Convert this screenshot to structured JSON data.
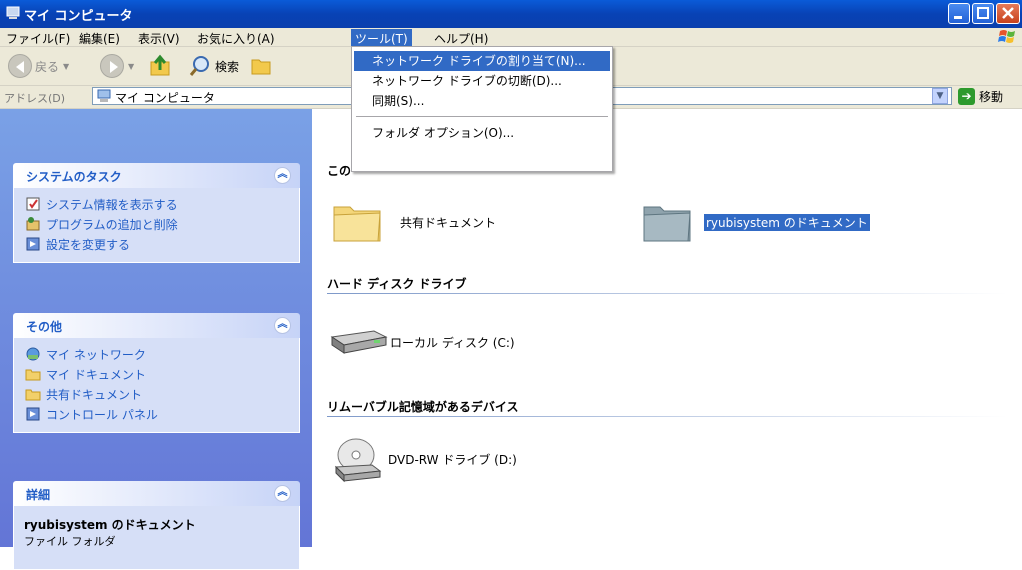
{
  "window": {
    "title": "マイ コンピュータ"
  },
  "menubar": {
    "items": [
      {
        "label": "ファイル(F)"
      },
      {
        "label": "編集(E)"
      },
      {
        "label": "表示(V)"
      },
      {
        "label": "お気に入り(A)"
      },
      {
        "label": "ツール(T)",
        "active": true
      },
      {
        "label": "ヘルプ(H)"
      }
    ]
  },
  "toolbar": {
    "back_label": "戻る",
    "search_label": "検索"
  },
  "address": {
    "label": "アドレス(D)",
    "value": "マイ コンピュータ",
    "go_label": "移動"
  },
  "tools_menu": {
    "items": [
      {
        "label": "ネットワーク ドライブの割り当て(N)...",
        "highlighted": true
      },
      {
        "label": "ネットワーク ドライブの切断(D)..."
      },
      {
        "label": "同期(S)..."
      },
      {
        "label": "フォルダ オプション(O)..."
      }
    ]
  },
  "sidebar": {
    "system_tasks": {
      "title": "システムのタスク",
      "items": [
        "システム情報を表示する",
        "プログラムの追加と削除",
        "設定を変更する"
      ]
    },
    "other_places": {
      "title": "その他",
      "items": [
        "マイ ネットワーク",
        "マイ ドキュメント",
        "共有ドキュメント",
        "コントロール パネル"
      ]
    },
    "details": {
      "title": "詳細",
      "name": "ryubisystem のドキュメント",
      "type": "ファイル フォルダ"
    }
  },
  "content": {
    "group_files_partial": "この",
    "group_hdd": "ハード ディスク ドライブ",
    "group_removable": "リムーバブル記憶域があるデバイス",
    "shared_docs": "共有ドキュメント",
    "user_docs": "ryubisystem のドキュメント",
    "local_disk": "ローカル ディスク (C:)",
    "dvd_drive": "DVD-RW ドライブ (D:)"
  },
  "colors": {
    "accent": "#316ac5",
    "titlebar": "#0a5bd8",
    "sidebar_link": "#215dc6"
  }
}
